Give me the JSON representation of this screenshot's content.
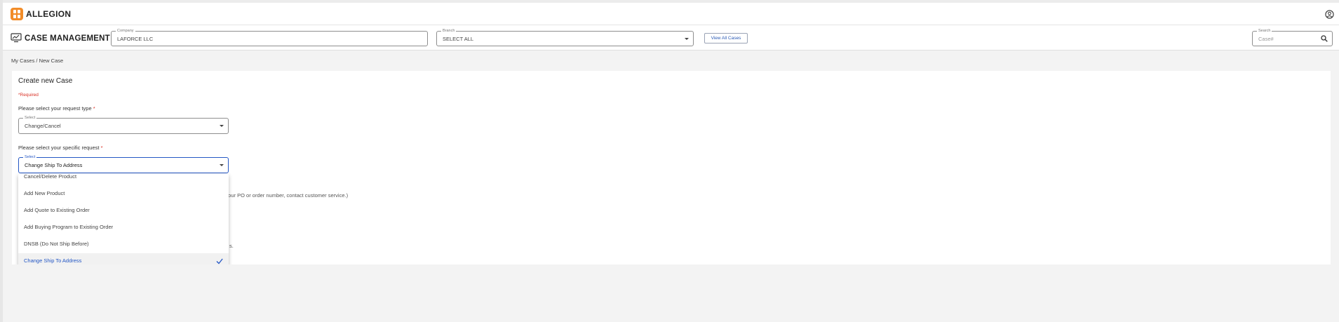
{
  "app": {
    "brand": "ALLEGION",
    "section_title": "CASE MANAGEMENT"
  },
  "icons": {
    "logo": "allegion-logo-icon",
    "user": "user-circle-icon",
    "case_mgmt": "monitor-chart-icon",
    "search": "search-icon",
    "check": "check-icon",
    "caret": "caret-down-icon"
  },
  "colors": {
    "accent": "#2457c5",
    "required": "#d93025",
    "logo": "#f28c28"
  },
  "header": {
    "company": {
      "label": "Company",
      "value": "LAFORCE LLC"
    },
    "branch": {
      "label": "Branch",
      "value": "SELECT ALL"
    },
    "view_all_label": "View All Cases",
    "search": {
      "label": "Search",
      "placeholder": "Case#"
    }
  },
  "breadcrumb": "My Cases / New Case",
  "form": {
    "title": "Create new Case",
    "required_note": "*Required",
    "request_type": {
      "question": "Please select your request type",
      "star": "*",
      "select_label": "Select",
      "value": "Change/Cancel"
    },
    "specific_request": {
      "question": "Please select your specific request",
      "star": "*",
      "select_label": "Select",
      "value": "Change Ship To Address"
    },
    "partial_text_1": "nd your PO or order number, contact customer service.)",
    "partial_text_2": "s."
  },
  "dropdown": {
    "options": [
      "Cancel/Delete Product",
      "Add New Product",
      "Add Quote to Existing Order",
      "Add Buying Program to Existing Order",
      "DNSB (Do Not Ship Before)",
      "Change Ship To Address"
    ],
    "selected": "Change Ship To Address"
  }
}
